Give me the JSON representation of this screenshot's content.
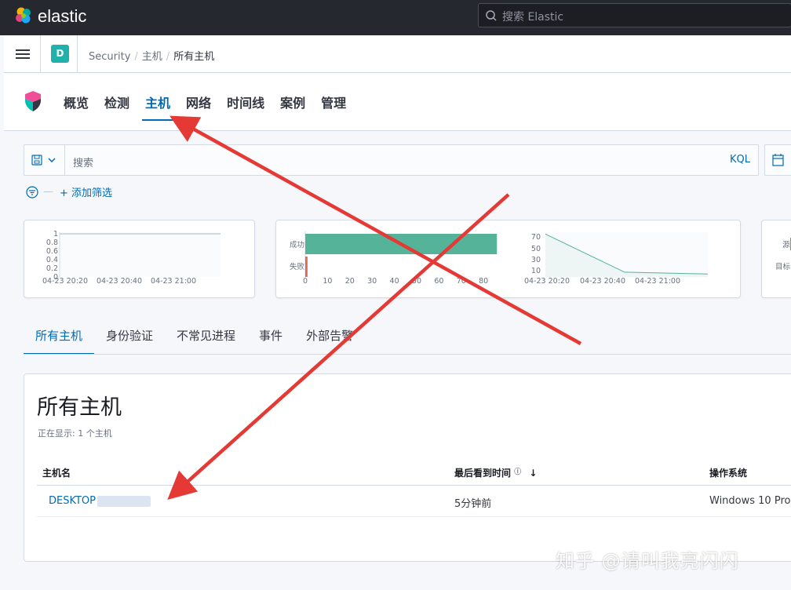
{
  "app": {
    "brand": "elastic",
    "global_search_placeholder": "搜索 Elastic"
  },
  "breadcrumbs": {
    "space_initial": "D",
    "items": [
      "Security",
      "主机",
      "所有主机"
    ]
  },
  "nav": {
    "tabs": [
      "概览",
      "检测",
      "主机",
      "网络",
      "时间线",
      "案例",
      "管理"
    ],
    "active": "主机"
  },
  "query": {
    "placeholder": "搜索",
    "language": "KQL",
    "add_filter": "+ 添加筛选"
  },
  "charts": {
    "hosts_timeline": {
      "type": "line",
      "y_ticks": [
        "1",
        "0.8",
        "0.6",
        "0.4",
        "0.2",
        "0"
      ],
      "x_ticks": [
        "04-23 20:20",
        "04-23 20:40",
        "04-23 21:00"
      ]
    },
    "auth_bar": {
      "type": "bar",
      "categories": [
        "成功",
        "失败"
      ],
      "values": [
        86,
        1
      ],
      "x_ticks": [
        "0",
        "10",
        "20",
        "30",
        "40",
        "50",
        "60",
        "70",
        "80"
      ],
      "colors": [
        "#54b399",
        "#e7664c"
      ]
    },
    "auth_area": {
      "type": "area",
      "y_ticks": [
        "70",
        "50",
        "30",
        "10"
      ],
      "x_ticks": [
        "04-23 20:20",
        "04-23 20:40",
        "04-23 21:00"
      ],
      "values": [
        72,
        8,
        5
      ],
      "color": "#54b399"
    },
    "ips": {
      "labels": [
        "源",
        "目标"
      ]
    }
  },
  "sub_tabs": {
    "items": [
      "所有主机",
      "身份验证",
      "不常见进程",
      "事件",
      "外部告警"
    ],
    "active": "所有主机"
  },
  "hosts_table": {
    "title": "所有主机",
    "showing": "正在显示: 1 个主机",
    "columns": [
      "主机名",
      "最后看到时间",
      "操作系统"
    ],
    "rows": [
      {
        "host": "DESKTOP",
        "last_seen": "5分钟前",
        "os": "Windows 10 Pro"
      }
    ]
  },
  "watermark": "知乎 @请叫我亮闪闪",
  "colors": {
    "accent": "#006bb4",
    "annotation_arrow": "#e53935",
    "header_bg": "#25282f"
  }
}
